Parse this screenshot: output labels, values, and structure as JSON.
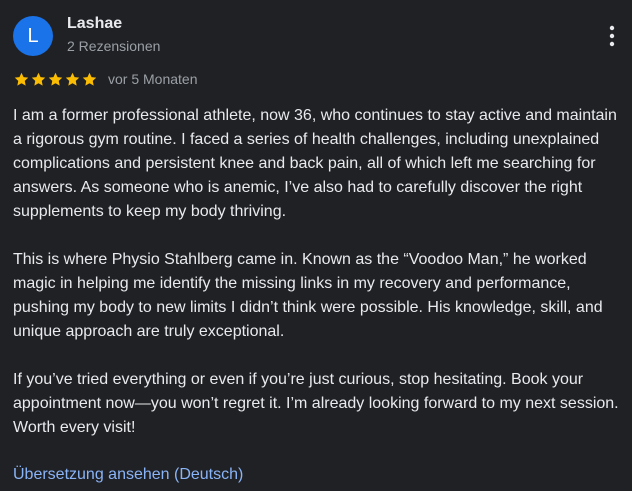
{
  "author": {
    "initial": "L",
    "name": "Lashae",
    "meta": "2 Rezensionen",
    "avatar_color": "#1a73e8"
  },
  "rating": {
    "stars": 5,
    "max_stars": 5,
    "star_color": "#fbbc04",
    "date": "vor 5 Monaten"
  },
  "more_menu_icon": "more-vertical-icon",
  "review": {
    "paragraphs": [
      "I am a former professional athlete, now 36, who continues to stay active and maintain a rigorous gym routine. I faced a series of health challenges, including unexplained complications and persistent knee and back pain, all of which left me searching for answers. As someone who is anemic, I’ve also had to carefully discover the right supplements to keep my body thriving.",
      "This is where Physio Stahlberg came in. Known as the “Voodoo Man,” he worked magic in helping me identify the missing links in my recovery and performance, pushing my body to new limits I didn’t think were possible. His knowledge, skill, and unique approach are truly exceptional.",
      "If you’ve tried everything or even if you’re just curious, stop hesitating. Book your appointment now—you won’t regret it. I’m already looking forward to my next session. Worth every visit!"
    ]
  },
  "translate_link": "Übersetzung ansehen (Deutsch)",
  "colors": {
    "background": "#202124",
    "text": "#e8eaed",
    "secondary_text": "#9aa0a6",
    "link": "#8ab4f8"
  }
}
